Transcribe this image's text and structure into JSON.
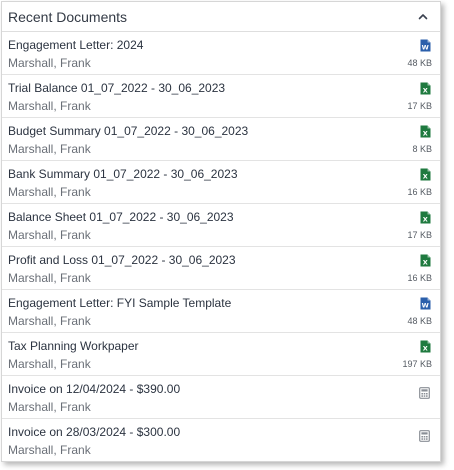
{
  "panel": {
    "title": "Recent Documents",
    "collapse_icon": "chevron-up-icon"
  },
  "colors": {
    "word": "#2b5fab",
    "excel": "#1f7a3f",
    "calculator": "#8a8f96"
  },
  "documents": [
    {
      "title": "Engagement Letter: 2024",
      "author": "Marshall, Frank",
      "file_type": "word",
      "icon": "word-file-icon",
      "size": "48 KB"
    },
    {
      "title": "Trial Balance 01_07_2022 - 30_06_2023",
      "author": "Marshall, Frank",
      "file_type": "excel",
      "icon": "excel-file-icon",
      "size": "17 KB"
    },
    {
      "title": "Budget Summary 01_07_2022 - 30_06_2023",
      "author": "Marshall, Frank",
      "file_type": "excel",
      "icon": "excel-file-icon",
      "size": "8 KB"
    },
    {
      "title": "Bank Summary 01_07_2022 - 30_06_2023",
      "author": "Marshall, Frank",
      "file_type": "excel",
      "icon": "excel-file-icon",
      "size": "16 KB"
    },
    {
      "title": "Balance Sheet 01_07_2022 - 30_06_2023",
      "author": "Marshall, Frank",
      "file_type": "excel",
      "icon": "excel-file-icon",
      "size": "17 KB"
    },
    {
      "title": "Profit and Loss 01_07_2022 - 30_06_2023",
      "author": "Marshall, Frank",
      "file_type": "excel",
      "icon": "excel-file-icon",
      "size": "16 KB"
    },
    {
      "title": "Engagement Letter: FYI Sample Template",
      "author": "Marshall, Frank",
      "file_type": "word",
      "icon": "word-file-icon",
      "size": "48 KB"
    },
    {
      "title": "Tax Planning Workpaper",
      "author": "Marshall, Frank",
      "file_type": "excel",
      "icon": "excel-file-icon",
      "size": "197 KB"
    },
    {
      "title": "Invoice on 12/04/2024 - $390.00",
      "author": "Marshall, Frank",
      "file_type": "invoice",
      "icon": "calculator-icon",
      "size": ""
    },
    {
      "title": "Invoice on 28/03/2024 - $300.00",
      "author": "Marshall, Frank",
      "file_type": "invoice",
      "icon": "calculator-icon",
      "size": ""
    }
  ]
}
